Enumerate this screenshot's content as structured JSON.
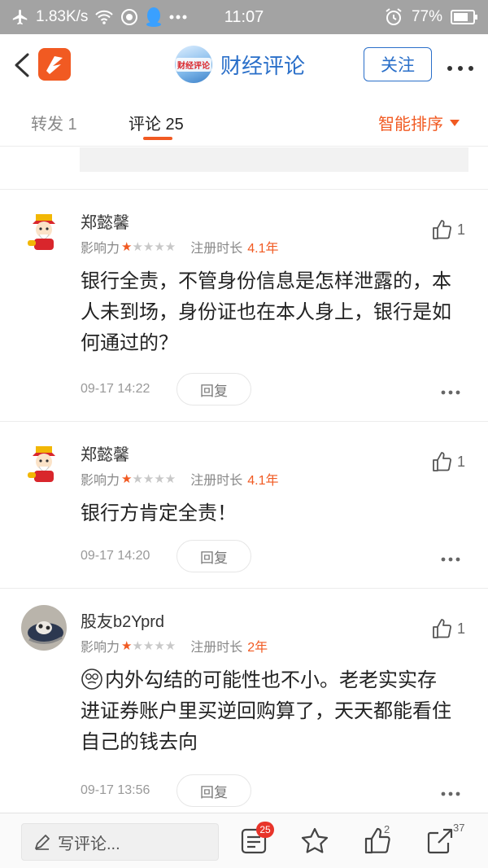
{
  "status_bar": {
    "speed": "1.83K/s",
    "time": "11:07",
    "battery": "77%",
    "icons": [
      "airplane-icon",
      "wifi-icon",
      "browser-icon",
      "qq-icon",
      "more-dots-icon",
      "alarm-icon",
      "battery-icon"
    ]
  },
  "header": {
    "account_name": "财经评论",
    "avatar_text": "财经评论",
    "follow_label": "关注"
  },
  "tabs": {
    "repost": "转发 1",
    "comments": "评论 25",
    "sort": "智能排序"
  },
  "comments": [
    {
      "name": "郑懿馨",
      "influence_label": "影响力",
      "stars": 1,
      "reg_label": "注册时长",
      "reg_value": "4.1年",
      "likes": "1",
      "body": "银行全责，不管身份信息是怎样泄露的，本人未到场，身份证也在本人身上，银行是如何通过的？",
      "time": "09-17 14:22",
      "reply_label": "回复"
    },
    {
      "name": "郑懿馨",
      "influence_label": "影响力",
      "stars": 1,
      "reg_label": "注册时长",
      "reg_value": "4.1年",
      "likes": "1",
      "body": "银行方肯定全责！",
      "time": "09-17 14:20",
      "reply_label": "回复"
    },
    {
      "name": "股友b2Yprd",
      "influence_label": "影响力",
      "stars": 1,
      "reg_label": "注册时长",
      "reg_value": "2年",
      "likes": "1",
      "body": "内外勾结的可能性也不小。老老实实存进证券账户里买逆回购算了，天天都能看住自己的钱去向",
      "time": "09-17 13:56",
      "reply_label": "回复"
    }
  ],
  "bottom_bar": {
    "write_placeholder": "写评论...",
    "comment_badge": "25",
    "like_count": "2",
    "share_count": "37"
  },
  "colors": {
    "accent": "#f15a22",
    "link_blue": "#2a6fc9",
    "status_bar": "#a3a3a3"
  }
}
